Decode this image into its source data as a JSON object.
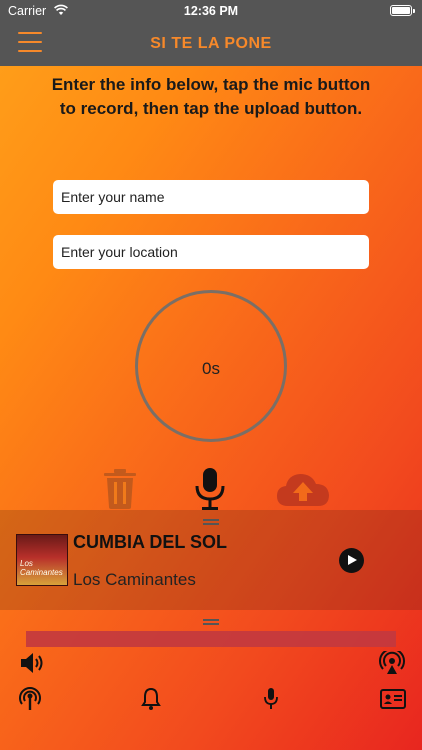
{
  "status_bar": {
    "carrier": "Carrier",
    "time": "12:36 PM"
  },
  "nav": {
    "title": "SI TE LA PONE"
  },
  "instructions": "Enter the info below, tap the mic button to record, then tap the upload button.",
  "form": {
    "name_placeholder": "Enter your name",
    "location_placeholder": "Enter your location"
  },
  "recorder": {
    "elapsed": "0s"
  },
  "now_playing": {
    "title": "CUMBIA DEL SOL",
    "artist": "Los Caminantes",
    "album_art_label": "Los Caminantes"
  },
  "colors": {
    "header_bg": "#555555",
    "accent_orange": "#f7892a",
    "progress": "#c2383f"
  },
  "icons": {
    "menu": "hamburger-icon",
    "trash": "trash-icon",
    "mic": "mic-icon",
    "upload": "cloud-upload-icon",
    "play": "play-icon",
    "volume": "volume-icon",
    "airplay": "airplay-icon",
    "podcast": "podcast-icon",
    "bell": "bell-icon",
    "contact": "contact-card-icon"
  }
}
